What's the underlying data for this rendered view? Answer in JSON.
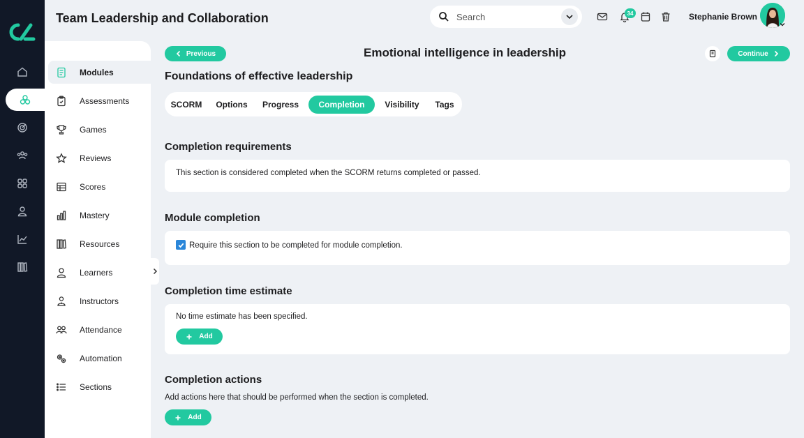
{
  "app": {
    "title": "Team Leadership and Collaboration"
  },
  "search": {
    "placeholder": "Search"
  },
  "header": {
    "notification_count": "34",
    "user_name": "Stephanie Brown"
  },
  "rail": {
    "items": [
      "home",
      "modules",
      "target",
      "people",
      "apps",
      "profile",
      "analytics",
      "library"
    ],
    "active": "modules"
  },
  "sidenav": {
    "items": [
      {
        "label": "Modules",
        "icon": "document-icon",
        "active": true
      },
      {
        "label": "Assessments",
        "icon": "clipboard-icon"
      },
      {
        "label": "Games",
        "icon": "trophy-icon"
      },
      {
        "label": "Reviews",
        "icon": "star-icon"
      },
      {
        "label": "Scores",
        "icon": "table-icon"
      },
      {
        "label": "Mastery",
        "icon": "bar-chart-icon"
      },
      {
        "label": "Resources",
        "icon": "books-icon"
      },
      {
        "label": "Learners",
        "icon": "person-icon"
      },
      {
        "label": "Instructors",
        "icon": "instructor-icon"
      },
      {
        "label": "Attendance",
        "icon": "group-icon"
      },
      {
        "label": "Automation",
        "icon": "gears-icon"
      },
      {
        "label": "Sections",
        "icon": "list-icon"
      }
    ]
  },
  "page": {
    "previous_label": "Previous",
    "continue_label": "Continue",
    "title": "Emotional intelligence in leadership",
    "section_title": "Foundations of effective leadership",
    "tabs": [
      "SCORM",
      "Options",
      "Progress",
      "Completion",
      "Visibility",
      "Tags"
    ],
    "active_tab": "Completion"
  },
  "completion_requirements": {
    "heading": "Completion requirements",
    "text": "This section is considered completed when the SCORM returns completed or passed."
  },
  "module_completion": {
    "heading": "Module completion",
    "checkbox_label": "Require this section to be completed for module completion.",
    "checked": true
  },
  "time_estimate": {
    "heading": "Completion time estimate",
    "text": "No time estimate has been specified.",
    "add_label": "Add"
  },
  "completion_actions": {
    "heading": "Completion actions",
    "text": "Add actions here that should be performed when the section is completed.",
    "add_label": "Add"
  },
  "colors": {
    "accent": "#22c9a0",
    "rail_bg": "#111827",
    "page_bg": "#eef1f5",
    "checkbox": "#2a86d9"
  }
}
